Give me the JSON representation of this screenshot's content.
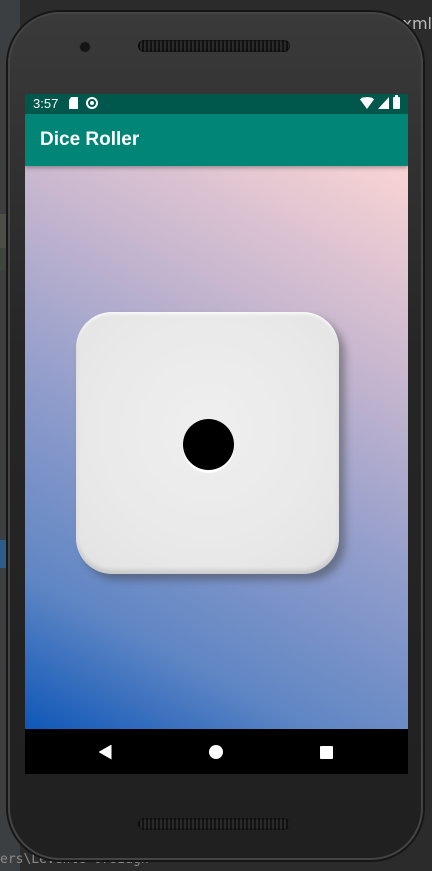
{
  "ide": {
    "bottom_path": "ers\\Levente-Orszagh",
    "tab_suffix": "xml"
  },
  "status_bar": {
    "time": "3:57",
    "left_icons": [
      "sd-card-icon",
      "sync-icon"
    ],
    "right_icons": [
      "wifi-icon",
      "signal-icon",
      "battery-icon"
    ]
  },
  "app_bar": {
    "title": "Dice Roller"
  },
  "dice": {
    "face_value": 1
  },
  "nav_bar": {
    "buttons": [
      "back-icon",
      "home-icon",
      "recent-apps-icon"
    ]
  },
  "colors": {
    "status_bar": "#00574B",
    "app_bar": "#008577",
    "nav_bar": "#000000",
    "gradient_top_right": "#FAD4D4",
    "gradient_bottom_left": "#0F57B8"
  }
}
